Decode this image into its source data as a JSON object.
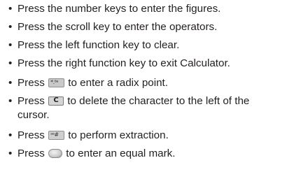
{
  "bullet_char": "•",
  "items": [
    {
      "text": "Press the number keys to enter the figures."
    },
    {
      "text": "Press the scroll key to enter the operators."
    },
    {
      "text": "Press the left function key to clear."
    },
    {
      "text": "Press the right function key to exit Calculator."
    },
    {
      "before": "Press",
      "key_label": "*.⁶ᵃ",
      "after": "to enter a radix point."
    },
    {
      "before": "Press",
      "key_label": "C",
      "after": "to delete the character to the left of the",
      "after_line2": "cursor."
    },
    {
      "before": "Press",
      "key_label": "ᵃᵃ#",
      "after": "to perform extraction."
    },
    {
      "before": "Press",
      "after": "to enter an equal mark."
    }
  ]
}
